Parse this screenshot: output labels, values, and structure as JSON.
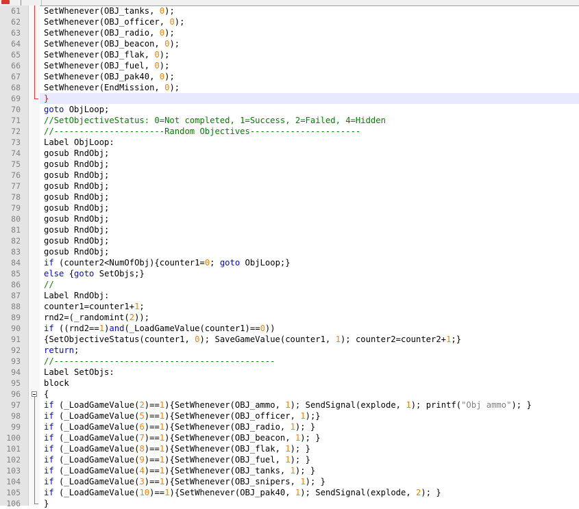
{
  "colors": {
    "keyword": "#0000ff",
    "number": "#ff8000",
    "comment": "#008000",
    "string": "#808080",
    "current_line": "#e8e8ff",
    "brace_match": "#ff0000"
  },
  "editor": {
    "current_line": 69,
    "lines": [
      {
        "n": "61",
        "fold": "red",
        "segs": [
          [
            "",
            "SetWhenever(OBJ_tanks, "
          ],
          [
            "num",
            "0"
          ],
          [
            "",
            ");"
          ]
        ]
      },
      {
        "n": "62",
        "fold": "red",
        "segs": [
          [
            "",
            "SetWhenever(OBJ_officer, "
          ],
          [
            "num",
            "0"
          ],
          [
            "",
            ");"
          ]
        ]
      },
      {
        "n": "63",
        "fold": "red",
        "segs": [
          [
            "",
            "SetWhenever(OBJ_radio, "
          ],
          [
            "num",
            "0"
          ],
          [
            "",
            ");"
          ]
        ]
      },
      {
        "n": "64",
        "fold": "red",
        "segs": [
          [
            "",
            "SetWhenever(OBJ_beacon, "
          ],
          [
            "num",
            "0"
          ],
          [
            "",
            ");"
          ]
        ]
      },
      {
        "n": "65",
        "fold": "red",
        "segs": [
          [
            "",
            "SetWhenever(OBJ_flak, "
          ],
          [
            "num",
            "0"
          ],
          [
            "",
            ");"
          ]
        ]
      },
      {
        "n": "66",
        "fold": "red",
        "segs": [
          [
            "",
            "SetWhenever(OBJ_fuel, "
          ],
          [
            "num",
            "0"
          ],
          [
            "",
            ");"
          ]
        ]
      },
      {
        "n": "67",
        "fold": "red",
        "segs": [
          [
            "",
            "SetWhenever(OBJ_pak40, "
          ],
          [
            "num",
            "0"
          ],
          [
            "",
            ");"
          ]
        ]
      },
      {
        "n": "68",
        "fold": "red",
        "segs": [
          [
            "",
            "SetWhenever(EndMission, "
          ],
          [
            "num",
            "0"
          ],
          [
            "",
            ");"
          ]
        ]
      },
      {
        "n": "69",
        "fold": "red-end",
        "segs": [
          [
            "brk",
            "}"
          ]
        ]
      },
      {
        "n": "70",
        "fold": "",
        "segs": [
          [
            "kw",
            "goto"
          ],
          [
            "",
            " ObjLoop;"
          ]
        ]
      },
      {
        "n": "71",
        "fold": "",
        "segs": [
          [
            "com",
            "//SetObjectiveStatus: 0=Not completed, 1=Success, 2=Failed, 4=Hidden"
          ]
        ]
      },
      {
        "n": "72",
        "fold": "",
        "segs": [
          [
            "com",
            "//----------------------Random Objectives----------------------"
          ]
        ]
      },
      {
        "n": "73",
        "fold": "",
        "segs": [
          [
            "",
            "Label ObjLoop:"
          ]
        ]
      },
      {
        "n": "74",
        "fold": "",
        "segs": [
          [
            "",
            "gosub RndObj;"
          ]
        ]
      },
      {
        "n": "75",
        "fold": "",
        "segs": [
          [
            "",
            "gosub RndObj;"
          ]
        ]
      },
      {
        "n": "76",
        "fold": "",
        "segs": [
          [
            "",
            "gosub RndObj;"
          ]
        ]
      },
      {
        "n": "77",
        "fold": "",
        "segs": [
          [
            "",
            "gosub RndObj;"
          ]
        ]
      },
      {
        "n": "78",
        "fold": "",
        "segs": [
          [
            "",
            "gosub RndObj;"
          ]
        ]
      },
      {
        "n": "79",
        "fold": "",
        "segs": [
          [
            "",
            "gosub RndObj;"
          ]
        ]
      },
      {
        "n": "80",
        "fold": "",
        "segs": [
          [
            "",
            "gosub RndObj;"
          ]
        ]
      },
      {
        "n": "81",
        "fold": "",
        "segs": [
          [
            "",
            "gosub RndObj;"
          ]
        ]
      },
      {
        "n": "82",
        "fold": "",
        "segs": [
          [
            "",
            "gosub RndObj;"
          ]
        ]
      },
      {
        "n": "83",
        "fold": "",
        "segs": [
          [
            "",
            "gosub RndObj;"
          ]
        ]
      },
      {
        "n": "84",
        "fold": "",
        "segs": [
          [
            "kw",
            "if"
          ],
          [
            "",
            " (counter2<NumOfObj){counter1="
          ],
          [
            "num",
            "0"
          ],
          [
            "",
            "; "
          ],
          [
            "kw",
            "goto"
          ],
          [
            "",
            " ObjLoop;}"
          ]
        ]
      },
      {
        "n": "85",
        "fold": "",
        "segs": [
          [
            "kw",
            "else"
          ],
          [
            "",
            " {"
          ],
          [
            "kw",
            "goto"
          ],
          [
            "",
            " SetObjs;}"
          ]
        ]
      },
      {
        "n": "86",
        "fold": "",
        "segs": [
          [
            "com",
            "//"
          ]
        ]
      },
      {
        "n": "87",
        "fold": "",
        "segs": [
          [
            "",
            "Label RndObj:"
          ]
        ]
      },
      {
        "n": "88",
        "fold": "",
        "segs": [
          [
            "",
            "counter1=counter1+"
          ],
          [
            "num",
            "1"
          ],
          [
            "",
            ";"
          ]
        ]
      },
      {
        "n": "89",
        "fold": "",
        "segs": [
          [
            "",
            "rnd2=(_randomint("
          ],
          [
            "num",
            "2"
          ],
          [
            "",
            "));"
          ]
        ]
      },
      {
        "n": "90",
        "fold": "",
        "segs": [
          [
            "kw",
            "if"
          ],
          [
            "",
            " ((rnd2=="
          ],
          [
            "num",
            "1"
          ],
          [
            "",
            ")"
          ],
          [
            "kw",
            "and"
          ],
          [
            "",
            "(_LoadGameValue(counter1)=="
          ],
          [
            "num",
            "0"
          ],
          [
            "",
            "))"
          ]
        ]
      },
      {
        "n": "91",
        "fold": "",
        "segs": [
          [
            "",
            "{SetObjectiveStatus(counter1, "
          ],
          [
            "num",
            "0"
          ],
          [
            "",
            "); SaveGameValue(counter1, "
          ],
          [
            "num",
            "1"
          ],
          [
            "",
            "); counter2=counter2+"
          ],
          [
            "num",
            "1"
          ],
          [
            "",
            ";}"
          ]
        ]
      },
      {
        "n": "92",
        "fold": "",
        "segs": [
          [
            "kw",
            "return"
          ],
          [
            "",
            ";"
          ]
        ]
      },
      {
        "n": "93",
        "fold": "",
        "segs": [
          [
            "com",
            "//--------------------------------------------"
          ]
        ]
      },
      {
        "n": "94",
        "fold": "",
        "segs": [
          [
            "",
            "Label SetObjs:"
          ]
        ]
      },
      {
        "n": "95",
        "fold": "",
        "segs": [
          [
            "",
            "block"
          ]
        ]
      },
      {
        "n": "96",
        "fold": "box",
        "segs": [
          [
            "",
            "{"
          ]
        ]
      },
      {
        "n": "97",
        "fold": "line",
        "segs": [
          [
            "kw",
            "if"
          ],
          [
            "",
            " (_LoadGameValue("
          ],
          [
            "num",
            "2"
          ],
          [
            "",
            ")=="
          ],
          [
            "num",
            "1"
          ],
          [
            "",
            "){SetWhenever(OBJ_ammo, "
          ],
          [
            "num",
            "1"
          ],
          [
            "",
            "); SendSignal(explode, "
          ],
          [
            "num",
            "1"
          ],
          [
            "",
            "); printf("
          ],
          [
            "str",
            "\"Obj ammo\""
          ],
          [
            "",
            "); }"
          ]
        ]
      },
      {
        "n": "98",
        "fold": "line",
        "segs": [
          [
            "kw",
            "if"
          ],
          [
            "",
            " (_LoadGameValue("
          ],
          [
            "num",
            "5"
          ],
          [
            "",
            ")=="
          ],
          [
            "num",
            "1"
          ],
          [
            "",
            "){SetWhenever(OBJ_officer, "
          ],
          [
            "num",
            "1"
          ],
          [
            "",
            ");}"
          ]
        ]
      },
      {
        "n": "99",
        "fold": "line",
        "segs": [
          [
            "kw",
            "if"
          ],
          [
            "",
            " (_LoadGameValue("
          ],
          [
            "num",
            "6"
          ],
          [
            "",
            ")=="
          ],
          [
            "num",
            "1"
          ],
          [
            "",
            "){SetWhenever(OBJ_radio, "
          ],
          [
            "num",
            "1"
          ],
          [
            "",
            "); }"
          ]
        ]
      },
      {
        "n": "100",
        "fold": "line",
        "segs": [
          [
            "kw",
            "if"
          ],
          [
            "",
            " (_LoadGameValue("
          ],
          [
            "num",
            "7"
          ],
          [
            "",
            ")=="
          ],
          [
            "num",
            "1"
          ],
          [
            "",
            "){SetWhenever(OBJ_beacon, "
          ],
          [
            "num",
            "1"
          ],
          [
            "",
            "); }"
          ]
        ]
      },
      {
        "n": "101",
        "fold": "line",
        "segs": [
          [
            "kw",
            "if"
          ],
          [
            "",
            " (_LoadGameValue("
          ],
          [
            "num",
            "8"
          ],
          [
            "",
            ")=="
          ],
          [
            "num",
            "1"
          ],
          [
            "",
            "){SetWhenever(OBJ_flak, "
          ],
          [
            "num",
            "1"
          ],
          [
            "",
            "); }"
          ]
        ]
      },
      {
        "n": "102",
        "fold": "line",
        "segs": [
          [
            "kw",
            "if"
          ],
          [
            "",
            " (_LoadGameValue("
          ],
          [
            "num",
            "9"
          ],
          [
            "",
            ")=="
          ],
          [
            "num",
            "1"
          ],
          [
            "",
            "){SetWhenever(OBJ_fuel, "
          ],
          [
            "num",
            "1"
          ],
          [
            "",
            "); }"
          ]
        ]
      },
      {
        "n": "103",
        "fold": "line",
        "segs": [
          [
            "kw",
            "if"
          ],
          [
            "",
            " (_LoadGameValue("
          ],
          [
            "num",
            "4"
          ],
          [
            "",
            ")=="
          ],
          [
            "num",
            "1"
          ],
          [
            "",
            "){SetWhenever(OBJ_tanks, "
          ],
          [
            "num",
            "1"
          ],
          [
            "",
            "); }"
          ]
        ]
      },
      {
        "n": "104",
        "fold": "line",
        "segs": [
          [
            "kw",
            "if"
          ],
          [
            "",
            " (_LoadGameValue("
          ],
          [
            "num",
            "3"
          ],
          [
            "",
            ")=="
          ],
          [
            "num",
            "1"
          ],
          [
            "",
            "){SetWhenever(OBJ_snipers, "
          ],
          [
            "num",
            "1"
          ],
          [
            "",
            "); }"
          ]
        ]
      },
      {
        "n": "105",
        "fold": "line",
        "segs": [
          [
            "kw",
            "if"
          ],
          [
            "",
            " (_LoadGameValue("
          ],
          [
            "num",
            "10"
          ],
          [
            "",
            ")=="
          ],
          [
            "num",
            "1"
          ],
          [
            "",
            "){SetWhenever(OBJ_pak40, "
          ],
          [
            "num",
            "1"
          ],
          [
            "",
            "); SendSignal(explode, "
          ],
          [
            "num",
            "2"
          ],
          [
            "",
            "); }"
          ]
        ]
      },
      {
        "n": "106",
        "fold": "end",
        "segs": [
          [
            "",
            "}"
          ]
        ]
      }
    ]
  }
}
